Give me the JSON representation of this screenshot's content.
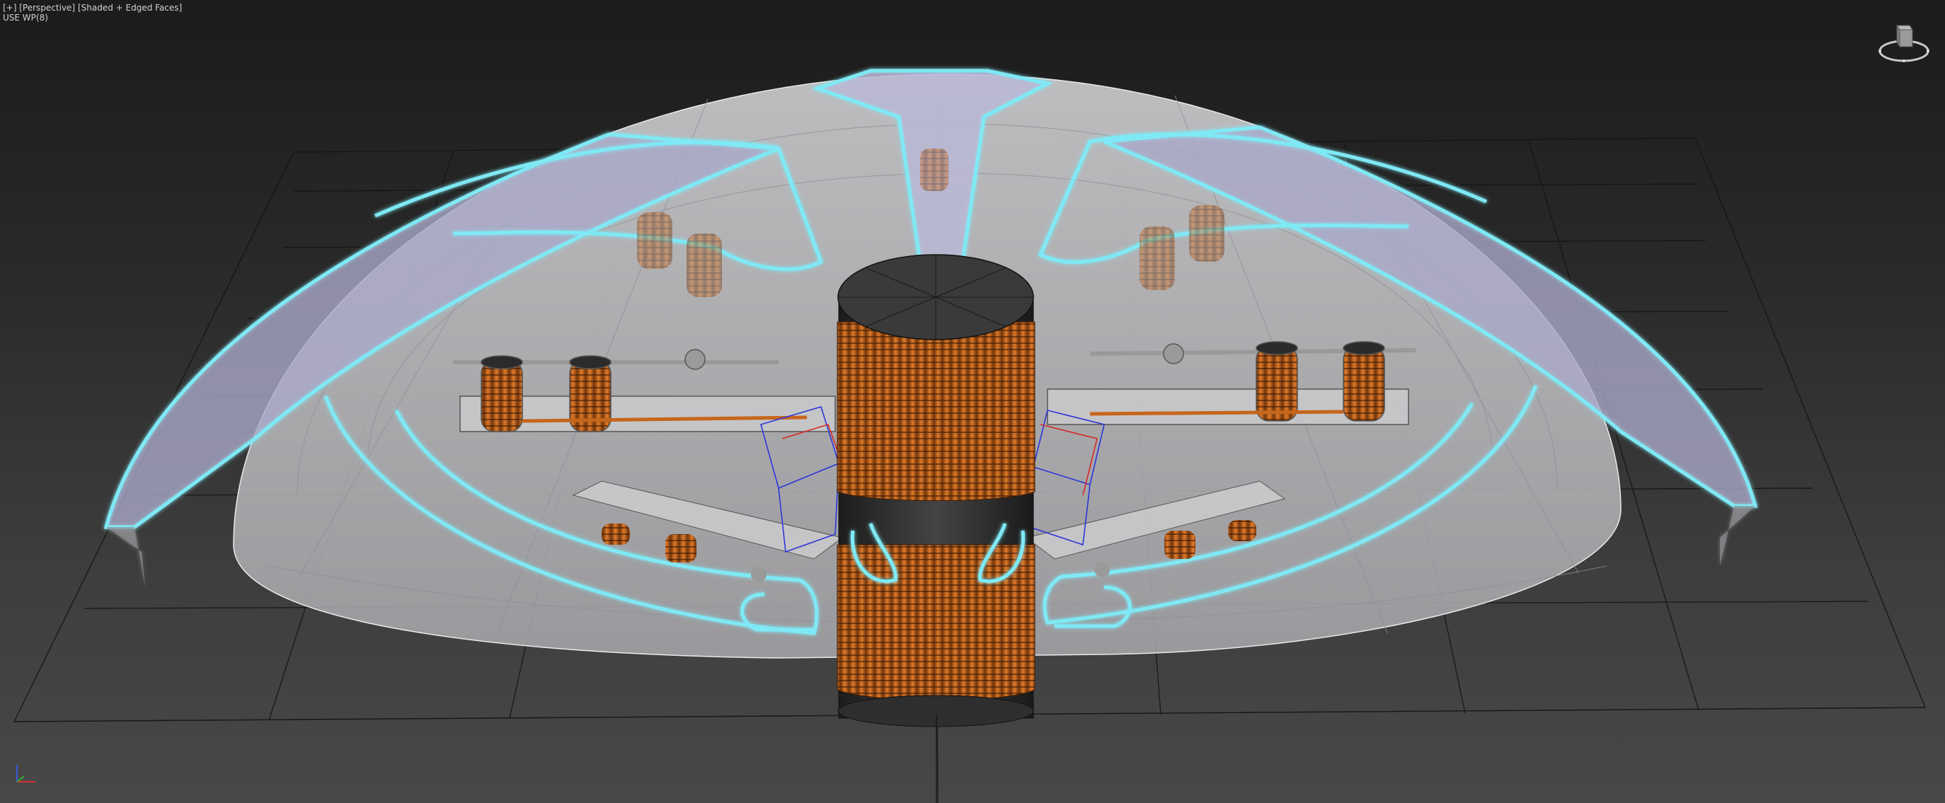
{
  "viewport": {
    "menu": {
      "plus_label": "[+]",
      "view_label": "[Perspective]",
      "shading_label": "[Shaded + Edged Faces]"
    },
    "workplane_label": "USE WP(8)"
  },
  "viewcube": {
    "icon": "viewcube-icon"
  },
  "axis_tripod": {
    "icon": "axis-tripod-icon"
  },
  "colors": {
    "background_top": "#1b1b1b",
    "background_bottom": "#484848",
    "grid": "#121212",
    "shell": "#c9c9cc",
    "selection_highlight": "#7fe9f5",
    "copper": "#c7651c",
    "core": "#2e2e2e"
  }
}
